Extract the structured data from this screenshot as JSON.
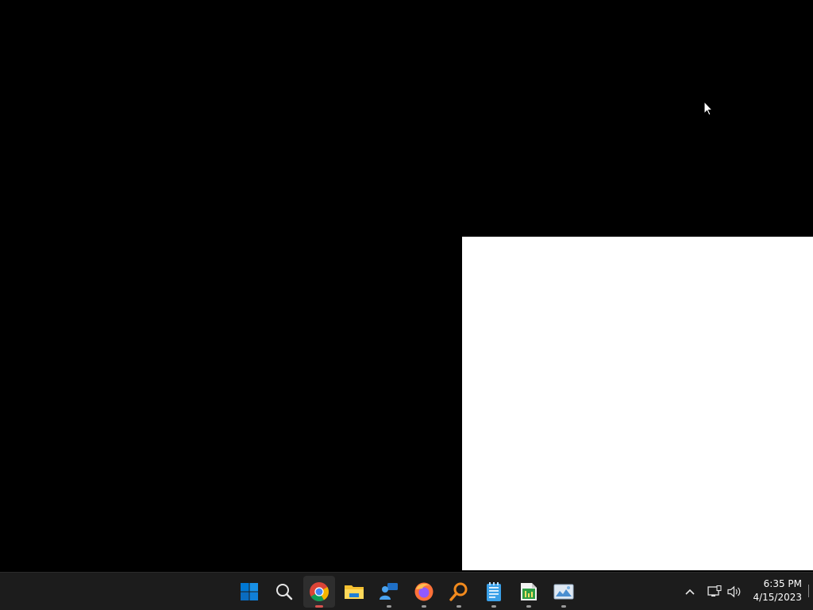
{
  "taskbar": {
    "apps": [
      {
        "icon": "windows-start-icon",
        "active": false,
        "running": false
      },
      {
        "icon": "search-icon",
        "active": false,
        "running": false
      },
      {
        "icon": "chrome-icon",
        "active": true,
        "running": true
      },
      {
        "icon": "file-explorer-icon",
        "active": false,
        "running": false
      },
      {
        "icon": "people-app-icon",
        "active": false,
        "running": true
      },
      {
        "icon": "firefox-icon",
        "active": false,
        "running": true
      },
      {
        "icon": "search-tool-icon",
        "active": false,
        "running": true
      },
      {
        "icon": "notepad-icon",
        "active": false,
        "running": true
      },
      {
        "icon": "spreadsheet-editor-icon",
        "active": false,
        "running": true
      },
      {
        "icon": "image-viewer-icon",
        "active": false,
        "running": true
      }
    ],
    "tray": {
      "chevron_icon": "chevron-up-icon",
      "network_icon": "network-icon",
      "volume_icon": "volume-icon"
    },
    "clock": {
      "time": "6:35 PM",
      "date": "4/15/2023"
    }
  },
  "colors": {
    "desktop": "#000000",
    "taskbar": "#1c1c1c",
    "accent_windows": "#0078d4",
    "active_indicator": "#d9534f"
  }
}
